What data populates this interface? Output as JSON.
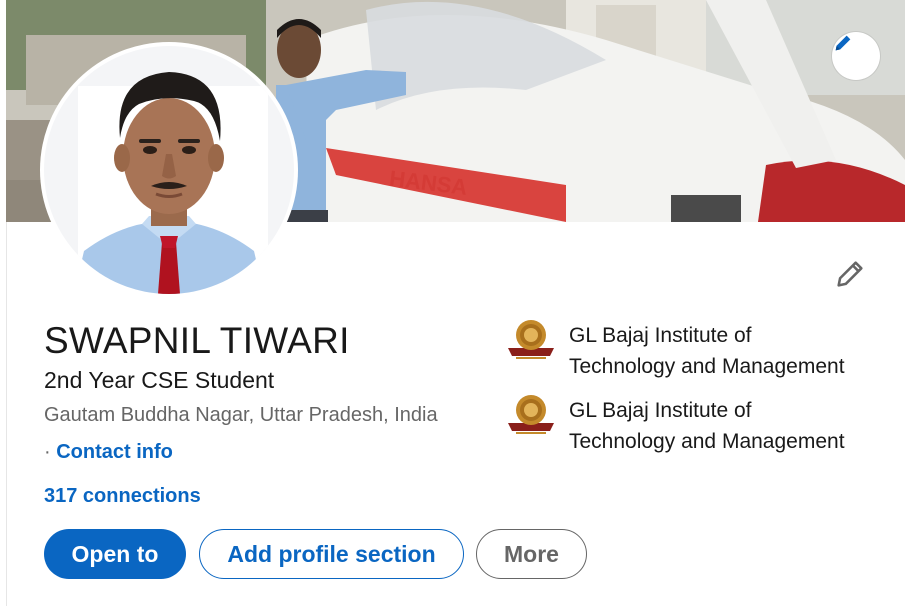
{
  "profile": {
    "name": "SWAPNIL TIWARI",
    "headline": "2nd Year CSE Student",
    "location": "Gautam Buddha Nagar, Uttar Pradesh, India",
    "contact_prefix": "·",
    "contact_label": "Contact info",
    "connections": "317 connections"
  },
  "cover": {
    "aircraft_text": "HANSA",
    "edit_icon": "pencil-icon"
  },
  "intro": {
    "edit_icon": "pencil-icon"
  },
  "education": [
    {
      "name_line1": "GL Bajaj Institute of",
      "name_line2": "Technology and Management",
      "logo": "institute-logo"
    },
    {
      "name_line1": "GL Bajaj Institute of",
      "name_line2": "Technology and Management",
      "logo": "institute-logo"
    }
  ],
  "actions": {
    "open_to": "Open to",
    "add_section": "Add profile section",
    "more": "More"
  },
  "colors": {
    "accent": "#0a66c2",
    "muted_text": "#666666"
  }
}
